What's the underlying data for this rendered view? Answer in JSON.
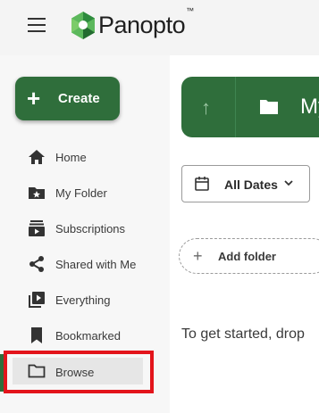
{
  "app": {
    "brand": "Panopto",
    "trademark": "™"
  },
  "create": {
    "label": "Create"
  },
  "nav": [
    {
      "label": "Home",
      "icon": "home-icon"
    },
    {
      "label": "My Folder",
      "icon": "star-folder-icon"
    },
    {
      "label": "Subscriptions",
      "icon": "subscriptions-icon"
    },
    {
      "label": "Shared with Me",
      "icon": "share-icon"
    },
    {
      "label": "Everything",
      "icon": "play-library-icon"
    },
    {
      "label": "Bookmarked",
      "icon": "bookmark-icon"
    },
    {
      "label": "Browse",
      "icon": "folder-outline-icon"
    }
  ],
  "header": {
    "title": "My"
  },
  "filters": {
    "dates_label": "All Dates"
  },
  "actions": {
    "add_folder_label": "Add folder"
  },
  "empty_state": {
    "message": "To get started, drop"
  },
  "colors": {
    "brand_green": "#2f6e3b",
    "highlight_red": "#e3141b"
  }
}
